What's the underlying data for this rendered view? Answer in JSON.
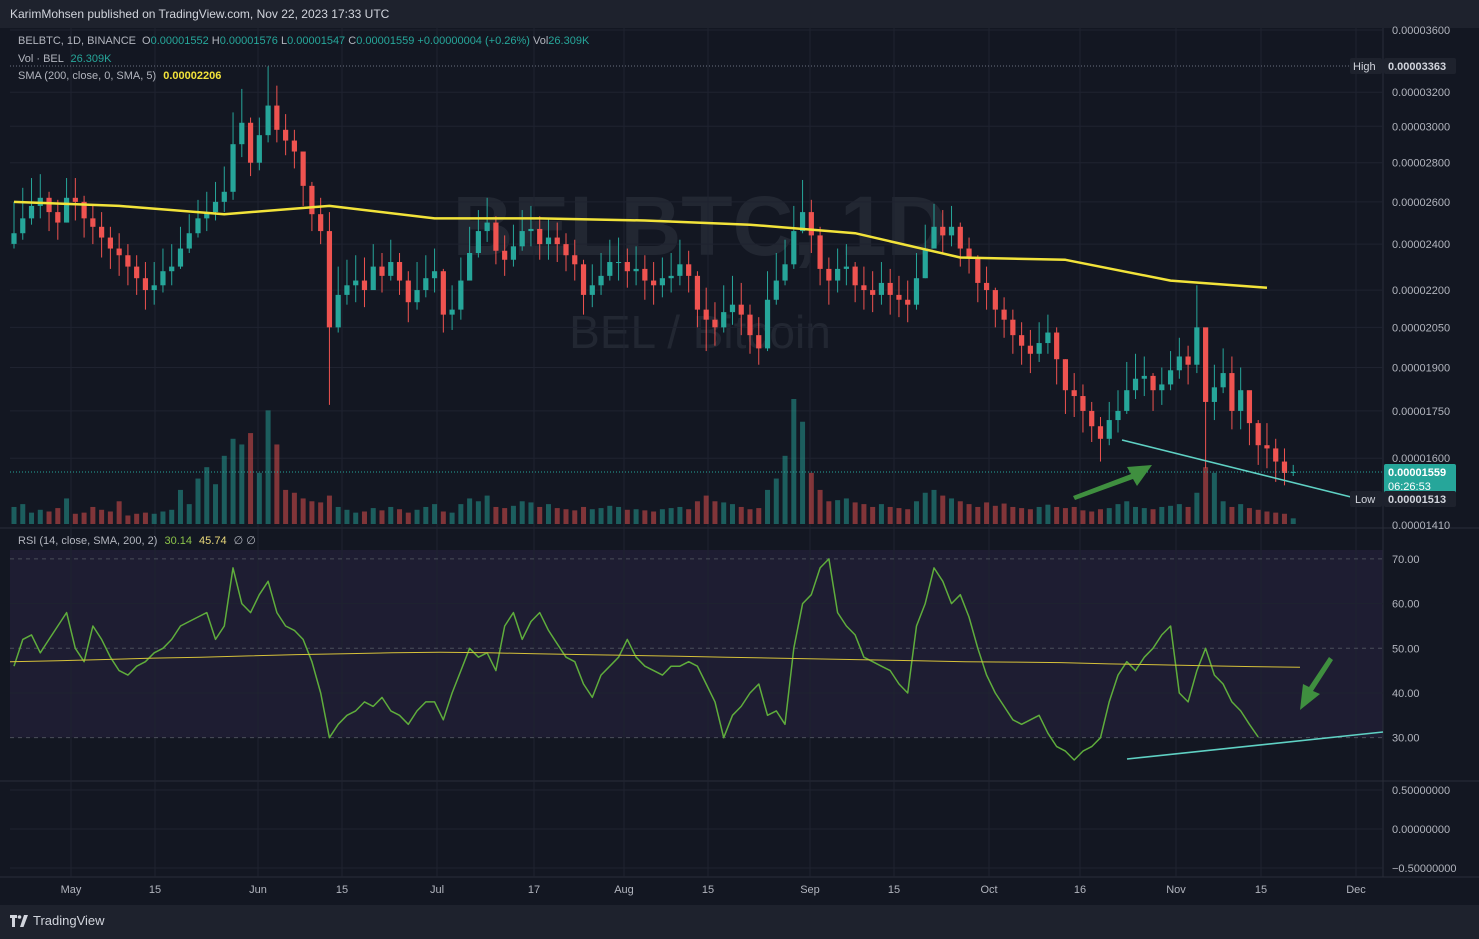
{
  "header": {
    "publisher": "KarimMohsen published on TradingView.com, Nov 22, 2023 17:33 UTC"
  },
  "footer": {
    "brand": "TradingView"
  },
  "watermark": {
    "symbol": "BELBTC, 1D",
    "pair": "BEL / Bitcoin"
  },
  "legend": {
    "symbol": "BELBTC, 1D, BINANCE",
    "o_label": "O",
    "o_val": "0.00001552",
    "h_label": "H",
    "h_val": "0.00001576",
    "l_label": "L",
    "l_val": "0.00001547",
    "c_label": "C",
    "c_val": "0.00001559",
    "change": "+0.00000004 (+0.26%)",
    "vol_label": "Vol",
    "vol_val": "26.309K",
    "vol_line_label": "Vol · BEL",
    "vol_line_val": "26.309K",
    "sma_label": "SMA (200, close, 0, SMA, 5)",
    "sma_val": "0.00002206",
    "rsi_label": "RSI (14, close, SMA, 200, 2)",
    "rsi_val": "30.14",
    "rsi_ma_val": "45.74",
    "rsi_extra": "∅ ∅"
  },
  "axis": {
    "price_ticks": [
      "0.00003600",
      "0.00003200",
      "0.00003000",
      "0.00002800",
      "0.00002600",
      "0.00002400",
      "0.00002200",
      "0.00002050",
      "0.00001900",
      "0.00001750",
      "0.00001600",
      "0.00001410"
    ],
    "rsi_ticks": [
      "70.00",
      "60.00",
      "50.00",
      "40.00",
      "30.00"
    ],
    "lower_ticks": [
      "0.50000000",
      "0.00000000",
      "−0.50000000"
    ],
    "x_ticks": [
      "May",
      "15",
      "Jun",
      "15",
      "Jul",
      "17",
      "Aug",
      "15",
      "Sep",
      "15",
      "Oct",
      "16",
      "Nov",
      "15",
      "Dec"
    ]
  },
  "badges": {
    "high_label": "High",
    "high_val": "0.00003363",
    "last_val": "0.00001559",
    "countdown": "06:26:53",
    "low_label": "Low",
    "low_val": "0.00001513"
  },
  "colors": {
    "up": "#26a69a",
    "down": "#ef5350",
    "sma": "#f2e33a",
    "rsi": "#5fad3c",
    "rsi_ma": "#d5c13a",
    "trendline": "#5fd1c4",
    "arrow": "#3f8f3f",
    "background": "#131722"
  },
  "chart_data": [
    {
      "type": "candlestick",
      "title": "BELBTC, 1D, BINANCE",
      "x_labels": [
        "May",
        "15",
        "Jun",
        "15",
        "Jul",
        "17",
        "Aug",
        "15",
        "Sep",
        "15",
        "Oct",
        "16",
        "Nov",
        "15",
        "Dec"
      ],
      "ylim": [
        1.41e-05,
        3.6e-05
      ],
      "close": [
        2.45e-05,
        2.52e-05,
        2.58e-05,
        2.62e-05,
        2.55e-05,
        2.5e-05,
        2.62e-05,
        2.6e-05,
        2.52e-05,
        2.48e-05,
        2.43e-05,
        2.38e-05,
        2.35e-05,
        2.3e-05,
        2.25e-05,
        2.2e-05,
        2.22e-05,
        2.28e-05,
        2.3e-05,
        2.38e-05,
        2.45e-05,
        2.52e-05,
        2.55e-05,
        2.6e-05,
        2.65e-05,
        2.9e-05,
        3.02e-05,
        2.8e-05,
        2.95e-05,
        3.12e-05,
        2.98e-05,
        2.92e-05,
        2.86e-05,
        2.68e-05,
        2.54e-05,
        2.46e-05,
        2.05e-05,
        2.18e-05,
        2.22e-05,
        2.24e-05,
        2.2e-05,
        2.3e-05,
        2.26e-05,
        2.32e-05,
        2.24e-05,
        2.15e-05,
        2.2e-05,
        2.25e-05,
        2.28e-05,
        2.1e-05,
        2.12e-05,
        2.24e-05,
        2.36e-05,
        2.46e-05,
        2.5e-05,
        2.37e-05,
        2.33e-05,
        2.39e-05,
        2.46e-05,
        2.47e-05,
        2.4e-05,
        2.43e-05,
        2.4e-05,
        2.35e-05,
        2.31e-05,
        2.18e-05,
        2.22e-05,
        2.26e-05,
        2.32e-05,
        2.32e-05,
        2.28e-05,
        2.29e-05,
        2.24e-05,
        2.22e-05,
        2.25e-05,
        2.26e-05,
        2.31e-05,
        2.26e-05,
        2.12e-05,
        2.08e-05,
        2.05e-05,
        2.11e-05,
        2.14e-05,
        2.1e-05,
        2.02e-05,
        1.97e-05,
        2.16e-05,
        2.24e-05,
        2.31e-05,
        2.46e-05,
        2.55e-05,
        2.44e-05,
        2.29e-05,
        2.24e-05,
        2.29e-05,
        2.3e-05,
        2.22e-05,
        2.2e-05,
        2.18e-05,
        2.23e-05,
        2.18e-05,
        2.16e-05,
        2.14e-05,
        2.25e-05,
        2.38e-05,
        2.48e-05,
        2.44e-05,
        2.48e-05,
        2.38e-05,
        2.34e-05,
        2.23e-05,
        2.2e-05,
        2.12e-05,
        2.08e-05,
        2.02e-05,
        1.98e-05,
        1.95e-05,
        1.99e-05,
        2.03e-05,
        1.93e-05,
        1.82e-05,
        1.8e-05,
        1.75e-05,
        1.7e-05,
        1.66e-05,
        1.72e-05,
        1.75e-05,
        1.82e-05,
        1.86e-05,
        1.87e-05,
        1.82e-05,
        1.84e-05,
        1.89e-05,
        1.94e-05,
        1.91e-05,
        2.05e-05,
        1.78e-05,
        1.83e-05,
        1.88e-05,
        1.75e-05,
        1.82e-05,
        1.71e-05,
        1.64e-05,
        1.63e-05,
        1.59e-05,
        1.556e-05,
        1.559e-05
      ],
      "high": [
        2.6e-05,
        2.67e-05,
        2.72e-05,
        2.74e-05,
        2.65e-05,
        2.61e-05,
        2.72e-05,
        2.72e-05,
        2.63e-05,
        2.58e-05,
        2.55e-05,
        2.48e-05,
        2.45e-05,
        2.4e-05,
        2.35e-05,
        2.32e-05,
        2.32e-05,
        2.38e-05,
        2.4e-05,
        2.48e-05,
        2.54e-05,
        2.61e-05,
        2.65e-05,
        2.7e-05,
        2.78e-05,
        3.08e-05,
        3.22e-05,
        3.05e-05,
        3.05e-05,
        3.36e-05,
        3.24e-05,
        3.07e-05,
        2.98e-05,
        2.8e-05,
        2.7e-05,
        2.62e-05,
        2.55e-05,
        2.3e-05,
        2.33e-05,
        2.35e-05,
        2.34e-05,
        2.4e-05,
        2.36e-05,
        2.42e-05,
        2.36e-05,
        2.28e-05,
        2.32e-05,
        2.35e-05,
        2.38e-05,
        2.29e-05,
        2.22e-05,
        2.34e-05,
        2.48e-05,
        2.56e-05,
        2.62e-05,
        2.53e-05,
        2.44e-05,
        2.49e-05,
        2.56e-05,
        2.58e-05,
        2.53e-05,
        2.52e-05,
        2.5e-05,
        2.45e-05,
        2.42e-05,
        2.33e-05,
        2.31e-05,
        2.36e-05,
        2.42e-05,
        2.43e-05,
        2.38e-05,
        2.39e-05,
        2.35e-05,
        2.32e-05,
        2.34e-05,
        2.36e-05,
        2.42e-05,
        2.37e-05,
        2.28e-05,
        2.21e-05,
        2.15e-05,
        2.22e-05,
        2.26e-05,
        2.23e-05,
        2.14e-05,
        2.09e-05,
        2.28e-05,
        2.36e-05,
        2.42e-05,
        2.58e-05,
        2.71e-05,
        2.61e-05,
        2.48e-05,
        2.34e-05,
        2.38e-05,
        2.4e-05,
        2.32e-05,
        2.3e-05,
        2.28e-05,
        2.32e-05,
        2.29e-05,
        2.26e-05,
        2.24e-05,
        2.36e-05,
        2.49e-05,
        2.59e-05,
        2.56e-05,
        2.58e-05,
        2.5e-05,
        2.43e-05,
        2.35e-05,
        2.3e-05,
        2.21e-05,
        2.17e-05,
        2.12e-05,
        2.07e-05,
        2.04e-05,
        2.07e-05,
        2.1e-05,
        2.05e-05,
        1.93e-05,
        1.88e-05,
        1.84e-05,
        1.78e-05,
        1.73e-05,
        1.78e-05,
        1.82e-05,
        1.92e-05,
        1.95e-05,
        1.94e-05,
        1.88e-05,
        1.9e-05,
        1.96e-05,
        2.01e-05,
        1.98e-05,
        2.22e-05,
        2.02e-05,
        1.91e-05,
        1.97e-05,
        1.94e-05,
        1.9e-05,
        1.8e-05,
        1.72e-05,
        1.71e-05,
        1.66e-05,
        1.63e-05,
        1.58e-05
      ],
      "low": [
        2.38e-05,
        2.42e-05,
        2.49e-05,
        2.52e-05,
        2.46e-05,
        2.42e-05,
        2.5e-05,
        2.51e-05,
        2.43e-05,
        2.4e-05,
        2.34e-05,
        2.29e-05,
        2.26e-05,
        2.22e-05,
        2.18e-05,
        2.12e-05,
        2.14e-05,
        2.19e-05,
        2.22e-05,
        2.29e-05,
        2.36e-05,
        2.43e-05,
        2.46e-05,
        2.51e-05,
        2.55e-05,
        2.61e-05,
        2.83e-05,
        2.73e-05,
        2.76e-05,
        2.91e-05,
        2.91e-05,
        2.84e-05,
        2.77e-05,
        2.58e-05,
        2.46e-05,
        2.4e-05,
        1.77e-05,
        2.03e-05,
        2.14e-05,
        2.15e-05,
        2.13e-05,
        2.21e-05,
        2.19e-05,
        2.24e-05,
        2.18e-05,
        2.07e-05,
        2.12e-05,
        2.17e-05,
        2.19e-05,
        2.03e-05,
        2.04e-05,
        2.08e-05,
        2.25e-05,
        2.34e-05,
        2.41e-05,
        2.31e-05,
        2.26e-05,
        2.3e-05,
        2.37e-05,
        2.39e-05,
        2.33e-05,
        2.33e-05,
        2.32e-05,
        2.28e-05,
        2.24e-05,
        2.1e-05,
        2.13e-05,
        2.18e-05,
        2.24e-05,
        2.24e-05,
        2.21e-05,
        2.22e-05,
        2.16e-05,
        2.14e-05,
        2.17e-05,
        2.19e-05,
        2.22e-05,
        2.19e-05,
        2.05e-05,
        1.96e-05,
        1.98e-05,
        2.03e-05,
        2.06e-05,
        2.02e-05,
        1.95e-05,
        1.91e-05,
        1.96e-05,
        2.14e-05,
        2.22e-05,
        2.29e-05,
        2.45e-05,
        2.36e-05,
        2.22e-05,
        2.14e-05,
        2.19e-05,
        2.22e-05,
        2.15e-05,
        2.12e-05,
        2.11e-05,
        2.14e-05,
        2.1e-05,
        2.09e-05,
        2.07e-05,
        2.12e-05,
        2.25e-05,
        2.39e-05,
        2.36e-05,
        2.39e-05,
        2.3e-05,
        2.27e-05,
        2.15e-05,
        2.12e-05,
        2.05e-05,
        2.01e-05,
        1.95e-05,
        1.91e-05,
        1.88e-05,
        1.92e-05,
        1.95e-05,
        1.84e-05,
        1.74e-05,
        1.73e-05,
        1.68e-05,
        1.65e-05,
        1.59e-05,
        1.64e-05,
        1.68e-05,
        1.74e-05,
        1.79e-05,
        1.8e-05,
        1.75e-05,
        1.77e-05,
        1.82e-05,
        1.86e-05,
        1.84e-05,
        1.88e-05,
        1.57e-05,
        1.72e-05,
        1.81e-05,
        1.69e-05,
        1.69e-05,
        1.64e-05,
        1.58e-05,
        1.57e-05,
        1.53e-05,
        1.52e-05,
        1.547e-05
      ],
      "sma": [
        [
          0,
          2.6e-05
        ],
        [
          12,
          2.58e-05
        ],
        [
          24,
          2.54e-05
        ],
        [
          36,
          2.58e-05
        ],
        [
          48,
          2.52e-05
        ],
        [
          60,
          2.52e-05
        ],
        [
          72,
          2.51e-05
        ],
        [
          84,
          2.49e-05
        ],
        [
          96,
          2.45e-05
        ],
        [
          108,
          2.34e-05
        ],
        [
          120,
          2.33e-05
        ],
        [
          132,
          2.24e-05
        ],
        [
          143,
          2.21e-05
        ]
      ],
      "volume": [
        30,
        35,
        20,
        25,
        22,
        28,
        45,
        18,
        20,
        30,
        25,
        22,
        40,
        15,
        18,
        20,
        18,
        22,
        25,
        60,
        35,
        80,
        100,
        70,
        120,
        150,
        140,
        160,
        90,
        200,
        140,
        60,
        55,
        45,
        40,
        38,
        50,
        30,
        25,
        20,
        22,
        28,
        24,
        30,
        26,
        20,
        25,
        30,
        35,
        22,
        20,
        35,
        45,
        40,
        50,
        30,
        28,
        32,
        40,
        38,
        30,
        35,
        28,
        26,
        24,
        30,
        26,
        28,
        32,
        30,
        25,
        26,
        24,
        22,
        26,
        28,
        30,
        26,
        40,
        50,
        40,
        38,
        35,
        30,
        26,
        28,
        60,
        80,
        120,
        220,
        180,
        90,
        60,
        40,
        42,
        45,
        38,
        35,
        30,
        35,
        30,
        28,
        26,
        40,
        55,
        60,
        50,
        45,
        40,
        35,
        30,
        38,
        32,
        36,
        30,
        28,
        26,
        30,
        34,
        30,
        28,
        30,
        24,
        22,
        26,
        28,
        35,
        40,
        30,
        28,
        26,
        30,
        32,
        35,
        30,
        55,
        100,
        90,
        40,
        30,
        35,
        28,
        25,
        22,
        20,
        18,
        10
      ],
      "high_marker": 3.363e-05,
      "low_marker": 1.513e-05,
      "last_price": 1.559e-05
    },
    {
      "type": "line",
      "title": "RSI (14, close, SMA, 200, 2)",
      "ylim": [
        25,
        72
      ],
      "series": [
        {
          "values": [
            46,
            52,
            53,
            49,
            52,
            55,
            58,
            50,
            47,
            55,
            52,
            48,
            45,
            44,
            46,
            47,
            49,
            50,
            52,
            55,
            56,
            57,
            58,
            52,
            55,
            68,
            60,
            58,
            62,
            65,
            58,
            55,
            54,
            52,
            47,
            40,
            30,
            33,
            35,
            36,
            38,
            37,
            39,
            36,
            35,
            33,
            36,
            38,
            38,
            34,
            40,
            45,
            50,
            48,
            49,
            45,
            55,
            58,
            52,
            56,
            58,
            54,
            51,
            48,
            47,
            42,
            39,
            44,
            46,
            48,
            52,
            48,
            46,
            45,
            44,
            46,
            46,
            47,
            46,
            42,
            38,
            30,
            35,
            37,
            40,
            42,
            35,
            36,
            33,
            50,
            60,
            62,
            68,
            70,
            58,
            55,
            53,
            48,
            47,
            46,
            45,
            42,
            40,
            55,
            60,
            68,
            65,
            60,
            62,
            57,
            50,
            44,
            40,
            37,
            34,
            33,
            34,
            35,
            31,
            28,
            27,
            25,
            27,
            28,
            30,
            38,
            44,
            47,
            45,
            48,
            50,
            53,
            55,
            40,
            38,
            45,
            50,
            44,
            42,
            38,
            36,
            33,
            30.14
          ]
        },
        {
          "values": [
            47,
            47.2,
            47.5,
            47.8,
            48,
            48.3,
            48.6,
            48.8,
            49,
            49.1,
            49,
            48.8,
            48.6,
            48.4,
            48.2,
            48,
            47.8,
            47.6,
            47.4,
            47.2,
            47,
            46.9,
            46.8,
            46.5,
            46.3,
            46.1,
            45.9,
            45.74
          ]
        }
      ]
    },
    {
      "type": "line",
      "title": "",
      "ylim": [
        -0.5,
        0.5
      ],
      "series": []
    }
  ]
}
